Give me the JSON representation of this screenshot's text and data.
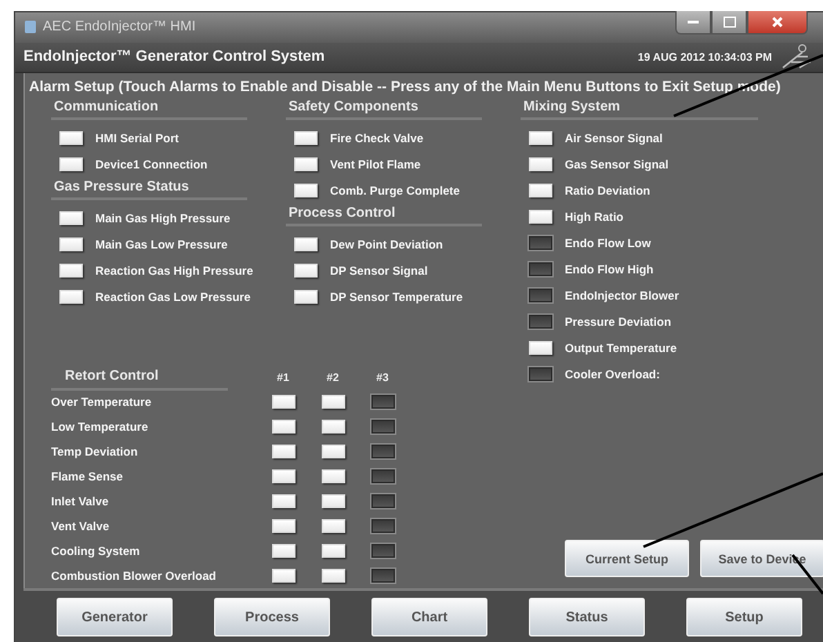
{
  "window": {
    "title": "AEC EndoInjector™ HMI"
  },
  "header": {
    "title": "EndoInjector™ Generator Control System",
    "datetime": "19 AUG 2012 10:34:03 PM"
  },
  "alarm_setup": {
    "title": "Alarm Setup (Touch Alarms to Enable and Disable -- Press any of the Main Menu Buttons to Exit Setup mode)",
    "columns": [
      [
        {
          "heading": "Communication",
          "alarms": [
            {
              "label": "HMI Serial Port",
              "enabled": true
            },
            {
              "label": "Device1 Connection",
              "enabled": true
            }
          ]
        },
        {
          "heading": "Gas Pressure Status",
          "alarms": [
            {
              "label": "Main Gas High Pressure",
              "enabled": true
            },
            {
              "label": "Main Gas Low Pressure",
              "enabled": true
            },
            {
              "label": "Reaction Gas High Pressure",
              "enabled": true
            },
            {
              "label": "Reaction Gas Low Pressure",
              "enabled": true
            }
          ]
        }
      ],
      [
        {
          "heading": "Safety Components",
          "alarms": [
            {
              "label": "Fire Check Valve",
              "enabled": true
            },
            {
              "label": "Vent Pilot Flame",
              "enabled": true
            },
            {
              "label": "Comb. Purge Complete",
              "enabled": true
            }
          ]
        },
        {
          "heading": "Process Control",
          "alarms": [
            {
              "label": "Dew Point Deviation",
              "enabled": true
            },
            {
              "label": "DP Sensor Signal",
              "enabled": true
            },
            {
              "label": "DP Sensor Temperature",
              "enabled": true
            }
          ]
        }
      ],
      [
        {
          "heading": "Mixing System",
          "alarms": [
            {
              "label": "Air Sensor Signal",
              "enabled": true
            },
            {
              "label": "Gas Sensor Signal",
              "enabled": true
            },
            {
              "label": "Ratio Deviation",
              "enabled": true
            },
            {
              "label": "High Ratio",
              "enabled": true
            },
            {
              "label": "Endo Flow Low",
              "enabled": false
            },
            {
              "label": "Endo Flow High",
              "enabled": false
            },
            {
              "label": "EndoInjector Blower",
              "enabled": false
            },
            {
              "label": "Pressure Deviation",
              "enabled": false
            },
            {
              "label": "Output Temperature",
              "enabled": true
            },
            {
              "label": "Cooler Overload:",
              "enabled": false
            }
          ]
        }
      ]
    ]
  },
  "retort_control": {
    "title": "Retort Control",
    "columns": [
      "#1",
      "#2",
      "#3"
    ],
    "rows": [
      {
        "label": "Over Temperature",
        "enabled": [
          true,
          true,
          false
        ]
      },
      {
        "label": "Low Temperature",
        "enabled": [
          true,
          true,
          false
        ]
      },
      {
        "label": "Temp Deviation",
        "enabled": [
          true,
          true,
          false
        ]
      },
      {
        "label": "Flame Sense",
        "enabled": [
          true,
          true,
          false
        ]
      },
      {
        "label": "Inlet Valve",
        "enabled": [
          true,
          true,
          false
        ]
      },
      {
        "label": "Vent Valve",
        "enabled": [
          true,
          true,
          false
        ]
      },
      {
        "label": "Cooling System",
        "enabled": [
          true,
          true,
          false
        ]
      },
      {
        "label": "Combustion Blower Overload",
        "enabled": [
          true,
          true,
          false
        ]
      }
    ]
  },
  "actions": [
    "Current Setup",
    "Save to Device"
  ],
  "nav_buttons": [
    "Generator",
    "Process",
    "Chart",
    "Status",
    "Setup"
  ]
}
